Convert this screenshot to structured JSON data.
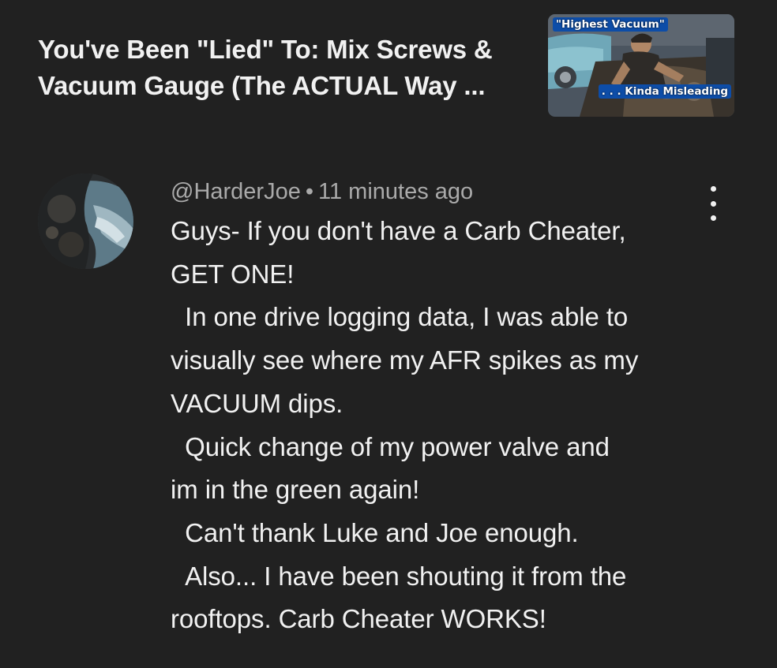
{
  "video": {
    "title_line1": "You've Been \"Lied\" To: Mix Screws &",
    "title_line2": "Vacuum Gauge (The ACTUAL Way ...",
    "thumbnail": {
      "caption_top": "\"Highest Vacuum\"",
      "caption_bottom": ". . . Kinda Misleading",
      "caption_color": "#0d4da8"
    }
  },
  "comment": {
    "author": "@HarderJoe",
    "separator": "•",
    "time": "11 minutes ago",
    "lines": [
      "Guys- If you don't have a Carb Cheater,",
      "GET ONE!",
      "  In one drive logging data, I was able to",
      "visually see where my AFR spikes as my",
      "VACUUM dips.",
      "  Quick change of my power valve and",
      "im in the green again!",
      "  Can't thank Luke and Joe enough.",
      "  Also... I have been shouting it from the",
      "rooftops. Carb Cheater WORKS!"
    ]
  },
  "icons": {
    "menu": "more-vert-icon"
  },
  "colors": {
    "background": "#212121",
    "primary_text": "#f1f1f1",
    "secondary_text": "#aaaaaa"
  }
}
